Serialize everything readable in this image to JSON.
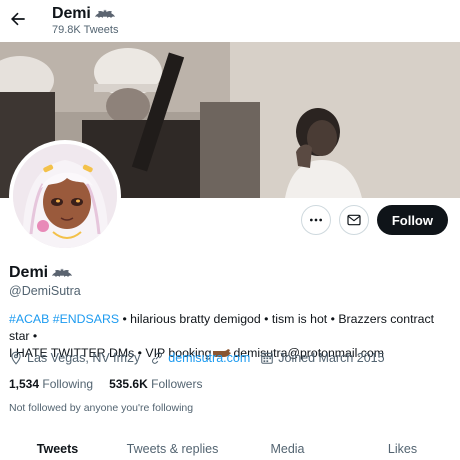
{
  "header": {
    "name": "Demi",
    "tweet_count": "79.8K Tweets"
  },
  "profile": {
    "display_name": "Demi",
    "handle": "@DemiSutra",
    "bio_tags": "#ACAB #ENDSARS",
    "bio_text_1": " • hilarious bratty demigod • tism is hot • Brazzers contract star •",
    "bio_text_2": "I HATE TWITTER DMs • VIP booking",
    "bio_email": "demisutra@protonmail.com",
    "location": "Las Vegas, NV fm2y",
    "website": "demisutra.com",
    "joined": "Joined March 2015",
    "following_count": "1,534",
    "following_label": "Following",
    "followers_count": "535.6K",
    "followers_label": "Followers",
    "not_followed_note": "Not followed by anyone you're following"
  },
  "actions": {
    "follow_label": "Follow",
    "more_icon": "more-icon",
    "message_icon": "message-icon"
  },
  "tabs": [
    {
      "label": "Tweets",
      "active": true
    },
    {
      "label": "Tweets & replies",
      "active": false
    },
    {
      "label": "Media",
      "active": false
    },
    {
      "label": "Likes",
      "active": false
    }
  ],
  "colors": {
    "accent": "#1d9bf0",
    "text": "#0f1419",
    "secondary": "#536471",
    "follow_button": "#0f1419"
  }
}
